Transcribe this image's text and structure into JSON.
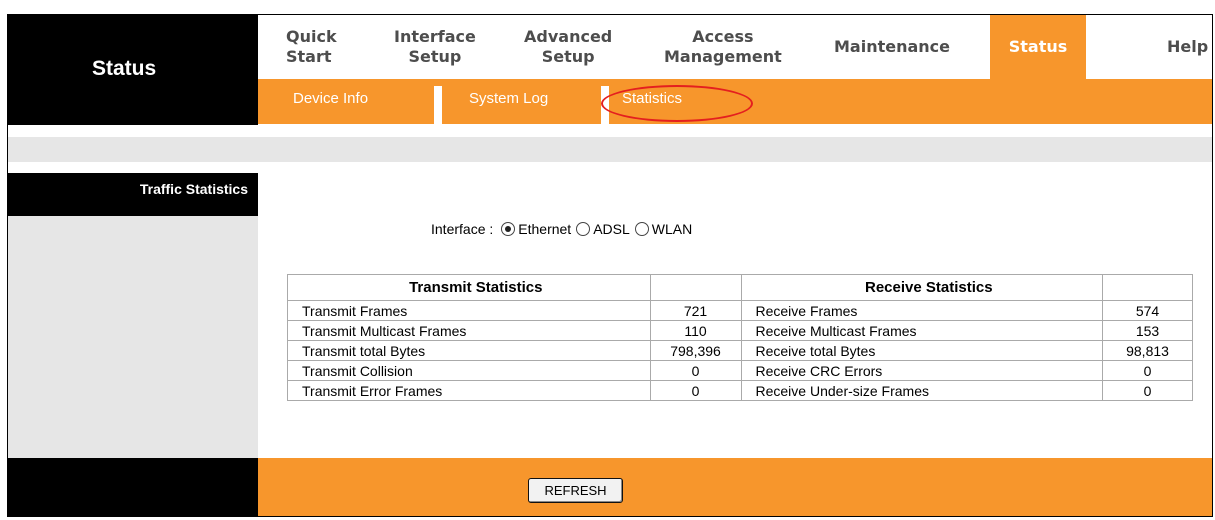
{
  "header": {
    "section_title": "Status"
  },
  "nav": {
    "quick_start": [
      "Quick",
      "Start"
    ],
    "interface_setup": [
      "Interface",
      "Setup"
    ],
    "advanced_setup": [
      "Advanced",
      "Setup"
    ],
    "access_management": [
      "Access",
      "Management"
    ],
    "maintenance": "Maintenance",
    "status": "Status",
    "help": "Help"
  },
  "subnav": {
    "device_info": "Device Info",
    "system_log": "System Log",
    "statistics": "Statistics"
  },
  "sidebar": {
    "label": "Traffic Statistics"
  },
  "interface": {
    "label": "Interface :",
    "options": [
      "Ethernet",
      "ADSL",
      "WLAN"
    ],
    "selected": "Ethernet"
  },
  "table": {
    "headers": {
      "transmit": "Transmit Statistics",
      "receive": "Receive Statistics"
    },
    "rows": [
      {
        "tx_label": "Transmit Frames",
        "tx_value": "721",
        "rx_label": "Receive Frames",
        "rx_value": "574"
      },
      {
        "tx_label": "Transmit Multicast Frames",
        "tx_value": "110",
        "rx_label": "Receive Multicast Frames",
        "rx_value": "153"
      },
      {
        "tx_label": "Transmit total Bytes",
        "tx_value": "798,396",
        "rx_label": "Receive total Bytes",
        "rx_value": "98,813"
      },
      {
        "tx_label": "Transmit Collision",
        "tx_value": "0",
        "rx_label": "Receive CRC Errors",
        "rx_value": "0"
      },
      {
        "tx_label": "Transmit Error Frames",
        "tx_value": "0",
        "rx_label": "Receive Under-size Frames",
        "rx_value": "0"
      }
    ]
  },
  "footer": {
    "refresh_label": "REFRESH"
  },
  "colors": {
    "accent": "#f7962c",
    "highlight": "#e41f1f",
    "panel_gray": "#e6e6e6"
  }
}
